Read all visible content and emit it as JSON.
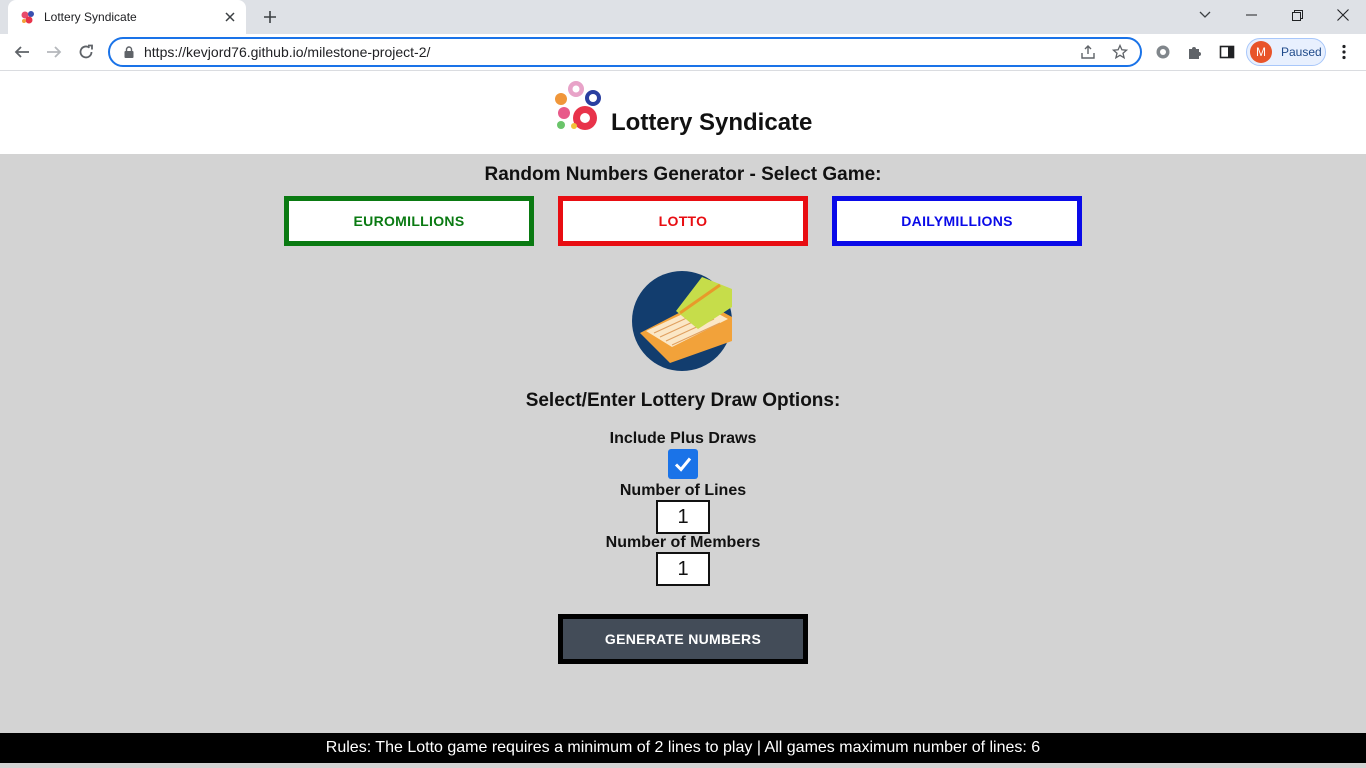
{
  "browser": {
    "tab_title": "Lottery Syndicate",
    "url": "https://kevjord76.github.io/milestone-project-2/",
    "profile_initial": "M",
    "profile_status": "Paused",
    "icons": [
      "back-icon",
      "forward-icon",
      "reload-icon",
      "lock-icon",
      "share-icon",
      "star-icon",
      "extension-icon",
      "puzzle-icon",
      "side-panel-icon",
      "menu-icon",
      "minimize-icon",
      "restore-icon",
      "close-icon",
      "new-tab-icon",
      "chevron-down-icon"
    ]
  },
  "site": {
    "title": "Lottery Syndicate"
  },
  "generator": {
    "heading": "Random Numbers Generator - Select Game:",
    "games": [
      {
        "label": "EUROMILLIONS",
        "color": "#0a7a12"
      },
      {
        "label": "LOTTO",
        "color": "#e80d12"
      },
      {
        "label": "DAILYMILLIONS",
        "color": "#0a0ae8"
      }
    ]
  },
  "options": {
    "heading": "Select/Enter Lottery Draw Options:",
    "plus_draws_label": "Include Plus Draws",
    "plus_draws_checked": true,
    "lines_label": "Number of Lines",
    "lines_value": "1",
    "members_label": "Number of Members",
    "members_value": "1"
  },
  "actions": {
    "generate_label": "GENERATE NUMBERS"
  },
  "footer": {
    "rules": "Rules: The Lotto game requires a minimum of 2 lines to play | All games maximum number of lines: 6"
  },
  "colors": {
    "page_bg": "#d3d3d3",
    "accent": "#1a73e8",
    "generate_bg": "#434c58"
  }
}
